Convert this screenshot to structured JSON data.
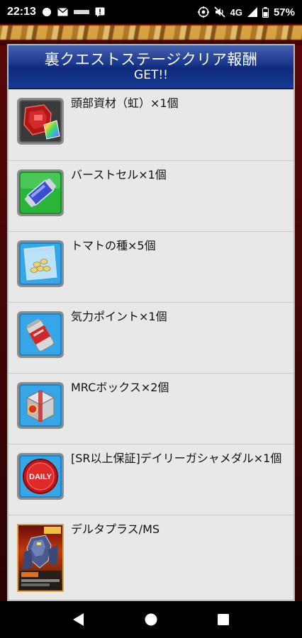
{
  "status_bar": {
    "time": "22:13",
    "network": "4G",
    "battery": "57%",
    "icons": [
      "circle-dot-icon",
      "mail-icon",
      "app-notification-icon",
      "alert-icon",
      "location-icon",
      "mute-icon",
      "signal-icon",
      "battery-icon"
    ]
  },
  "dialog": {
    "title_line1": "裏クエストステージクリア報酬",
    "title_line2": "GET!!"
  },
  "rewards": [
    {
      "label": "頭部資材（虹）×1個",
      "icon": "head-material-rainbow-icon"
    },
    {
      "label": "バーストセル×1個",
      "icon": "burst-cell-icon"
    },
    {
      "label": "トマトの種×5個",
      "icon": "tomato-seeds-icon"
    },
    {
      "label": "気力ポイント×1個",
      "icon": "energy-drink-icon"
    },
    {
      "label": "MRCボックス×2個",
      "icon": "mrc-box-icon"
    },
    {
      "label": "[SR以上保証]デイリーガシャメダル×1個",
      "icon": "daily-medal-icon",
      "medal_text": "DAILY"
    },
    {
      "label": "デルタプラス/MS",
      "icon": "delta-plus-card-icon"
    }
  ],
  "nav": {
    "back": "back-icon",
    "home": "home-icon",
    "recents": "recents-icon"
  }
}
